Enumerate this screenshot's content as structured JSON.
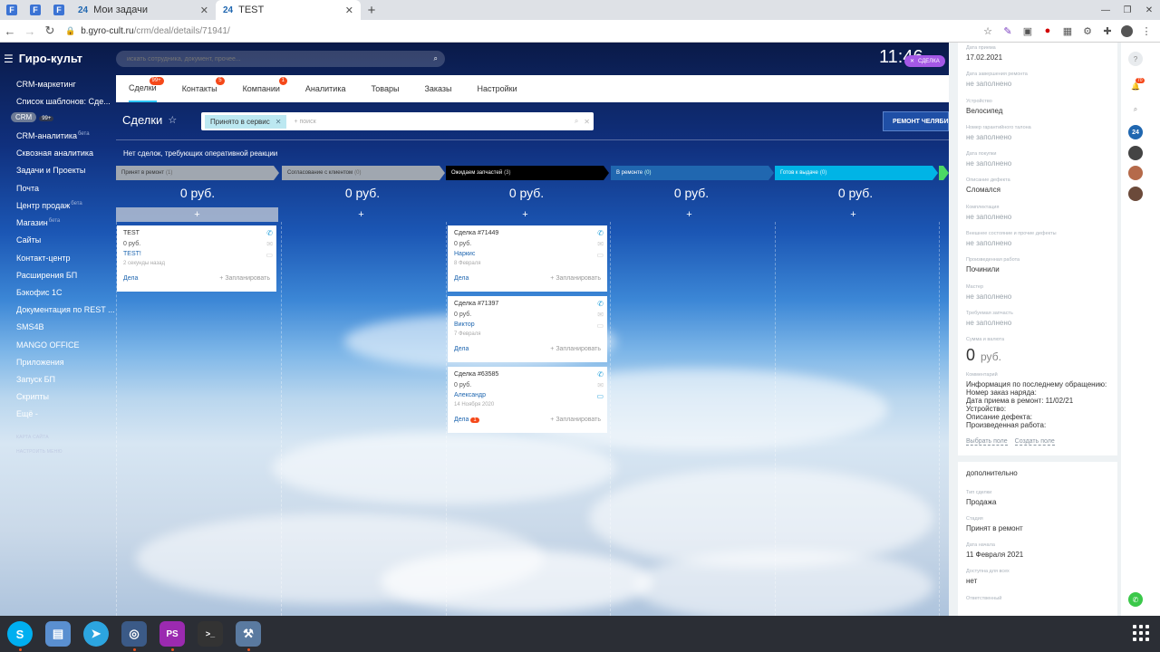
{
  "browser": {
    "tabs": [
      {
        "label": "Мои задачи"
      },
      {
        "label": "TEST"
      }
    ],
    "url_domain": "b.gyro-cult.ru",
    "url_path": "/crm/deal/details/71941/"
  },
  "app": {
    "brand": "Гиро-культ",
    "search_placeholder": "искать сотрудника, документ, прочее...",
    "clock": "11:46",
    "deal_chip": "СДЕЛКА"
  },
  "menu": {
    "items": [
      {
        "label": "CRM-маркетинг"
      },
      {
        "label": "Список шаблонов: Сде..."
      },
      {
        "label": "CRM",
        "badge": "99+"
      },
      {
        "label": "CRM-аналитика",
        "beta": "бета"
      },
      {
        "label": "Сквозная аналитика"
      },
      {
        "label": "Задачи и Проекты"
      },
      {
        "label": "Почта"
      },
      {
        "label": "Центр продаж",
        "beta": "бета"
      },
      {
        "label": "Магазин",
        "beta": "бета"
      },
      {
        "label": "Сайты"
      },
      {
        "label": "Контакт-центр"
      },
      {
        "label": "Расширения БП"
      },
      {
        "label": "Бэкофис 1С"
      },
      {
        "label": "Документация по REST ..."
      },
      {
        "label": "SMS4B"
      },
      {
        "label": "MANGO OFFICE"
      },
      {
        "label": "Приложения"
      },
      {
        "label": "Запуск БП"
      },
      {
        "label": "Скрипты"
      },
      {
        "label": "Ещё -"
      }
    ],
    "sitemap": "КАРТА САЙТА",
    "configure": "НАСТРОИТЬ МЕНЮ"
  },
  "modtabs": [
    {
      "label": "Сделки",
      "badge": "99+"
    },
    {
      "label": "Контакты",
      "badge": "5"
    },
    {
      "label": "Компании",
      "badge": "1"
    },
    {
      "label": "Аналитика"
    },
    {
      "label": "Товары"
    },
    {
      "label": "Заказы"
    },
    {
      "label": "Настройки"
    }
  ],
  "toolbar": {
    "title": "Сделки",
    "filter_tag": "Принято в сервис",
    "filter_placeholder": "+ поиск",
    "repair_button": "РЕМОНТ ЧЕЛЯБИНСК",
    "notice": "Нет сделок, требующих оперативной реакции"
  },
  "kanban": {
    "columns": [
      {
        "name": "Принят в ремонт",
        "count": "(1)",
        "sum": "0 руб.",
        "color": "#a0a7b0",
        "cards": [
          {
            "title": "TEST",
            "sum": "0 руб.",
            "who": "TEST!",
            "date": "2 секунды назад",
            "deals": "Дела",
            "plan": "+ Запланировать"
          }
        ]
      },
      {
        "name": "Согласование с клиентом",
        "count": "(0)",
        "sum": "0 руб.",
        "color": "#a0a7b0",
        "cards": []
      },
      {
        "name": "Ожидаем запчастей",
        "count": "(3)",
        "sum": "0 руб.",
        "color": "#000000",
        "cards": [
          {
            "title": "Сделка #71449",
            "sum": "0 руб.",
            "who": "Наркис",
            "date": "8 Февраля",
            "deals": "Дела",
            "plan": "+ Запланировать"
          },
          {
            "title": "Сделка #71397",
            "sum": "0 руб.",
            "who": "Виктор",
            "date": "7 Февраля",
            "deals": "Дела",
            "plan": "+ Запланировать"
          },
          {
            "title": "Сделка #63585",
            "sum": "0 руб.",
            "who": "Александр",
            "date": "14 Ноября 2020",
            "deals": "Дела",
            "badge": "1",
            "plan": "+ Запланировать"
          }
        ]
      },
      {
        "name": "В ремонте",
        "count": "(0)",
        "sum": "0 руб.",
        "color": "#2067b0",
        "cards": []
      },
      {
        "name": "Готов к выдаче",
        "count": "(0)",
        "sum": "0 руб.",
        "color": "#00b4e6",
        "cards": []
      }
    ]
  },
  "details": {
    "fields": [
      {
        "label": "Дата приема",
        "value": "17.02.2021"
      },
      {
        "label": "Дата завершения ремонта",
        "value": "не заполнено"
      },
      {
        "label": "Устройство",
        "value": "Велосипед"
      },
      {
        "label": "Номер гарантийного талона",
        "value": "не заполнено"
      },
      {
        "label": "Дата покупки",
        "value": "не заполнено"
      },
      {
        "label": "Описание дефекта",
        "value": "Сломался"
      },
      {
        "label": "Комплектация",
        "value": "не заполнено"
      },
      {
        "label": "Внешнее состояние и прочие дефекты",
        "value": "не заполнено"
      },
      {
        "label": "Произведенная работа",
        "value": "Починили"
      },
      {
        "label": "Мастер",
        "value": "не заполнено"
      },
      {
        "label": "Требуемая запчасть",
        "value": "не заполнено"
      }
    ],
    "amount_label": "Сумма и валюта",
    "amount": "0",
    "currency": "руб.",
    "comment_label": "Комментарий",
    "comment": "Информация по последнему обращению:\nНомер заказ наряда:\nДата приема в ремонт: 11/02/21\nУстройство:\nОписание дефекта:\nПроизведенная работа:",
    "select_field": "Выбрать поле",
    "create_field": "Создать поле",
    "extra_title": "дополнительно",
    "extra_fields": [
      {
        "label": "Тип сделки",
        "value": "Продажа"
      },
      {
        "label": "Стадия",
        "value": "Принят в ремонт"
      },
      {
        "label": "Дата начала",
        "value": "11 Февраля 2021"
      },
      {
        "label": "Доступна для всех",
        "value": "нет"
      },
      {
        "label": "Ответственный",
        "value": ""
      }
    ]
  },
  "rail": {
    "notif_badge": "70",
    "b24": "24"
  }
}
